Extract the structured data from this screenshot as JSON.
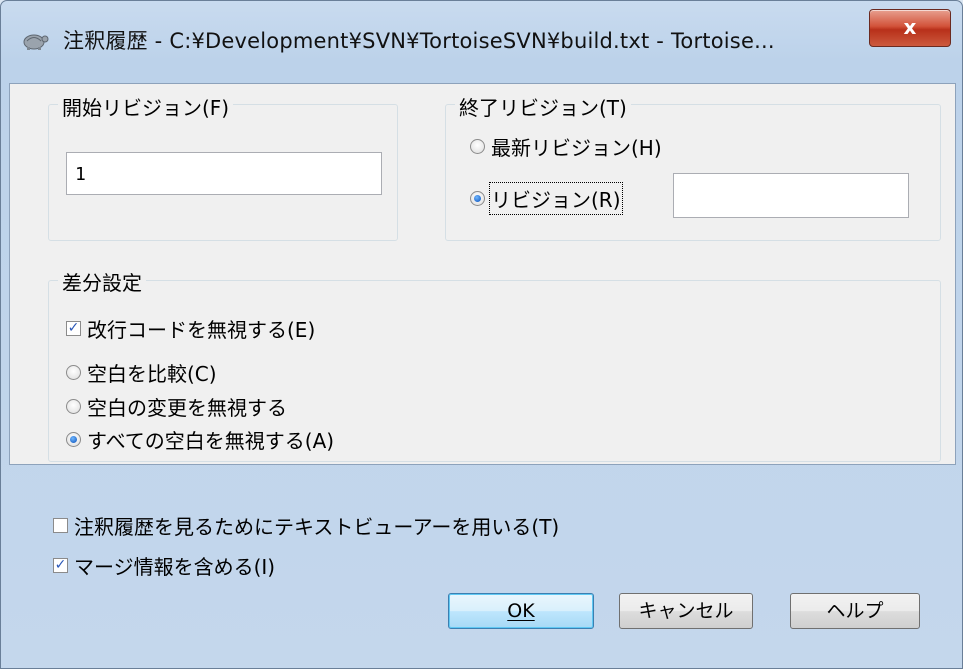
{
  "window": {
    "title": "注釈履歴 - C:¥Development¥SVN¥TortoiseSVN¥build.txt - Tortoise...",
    "close_label": "x"
  },
  "start_revision": {
    "label": "開始リビジョン(F)",
    "value": "1"
  },
  "end_revision": {
    "label": "終了リビジョン(T)",
    "head_option": "最新リビジョン(H)",
    "revision_option": "リビジョン(R)",
    "revision_value": "",
    "selected": "revision"
  },
  "diff_settings": {
    "label": "差分設定",
    "ignore_eol": {
      "label": "改行コードを無視する(E)",
      "checked": true
    },
    "whitespace_options": [
      {
        "label": "空白を比較(C)",
        "selected": false
      },
      {
        "label": "空白の変更を無視する",
        "selected": false
      },
      {
        "label": "すべての空白を無視する(A)",
        "selected": true
      }
    ]
  },
  "options": {
    "use_text_viewer": {
      "label": "注釈履歴を見るためにテキストビューアーを用いる(T)",
      "checked": false
    },
    "include_merge_info": {
      "label": "マージ情報を含める(I)",
      "checked": true
    }
  },
  "buttons": {
    "ok": "OK",
    "cancel": "キャンセル",
    "help": "ヘルプ"
  },
  "icons": {
    "app": "tortoise-icon",
    "check": "✓"
  }
}
